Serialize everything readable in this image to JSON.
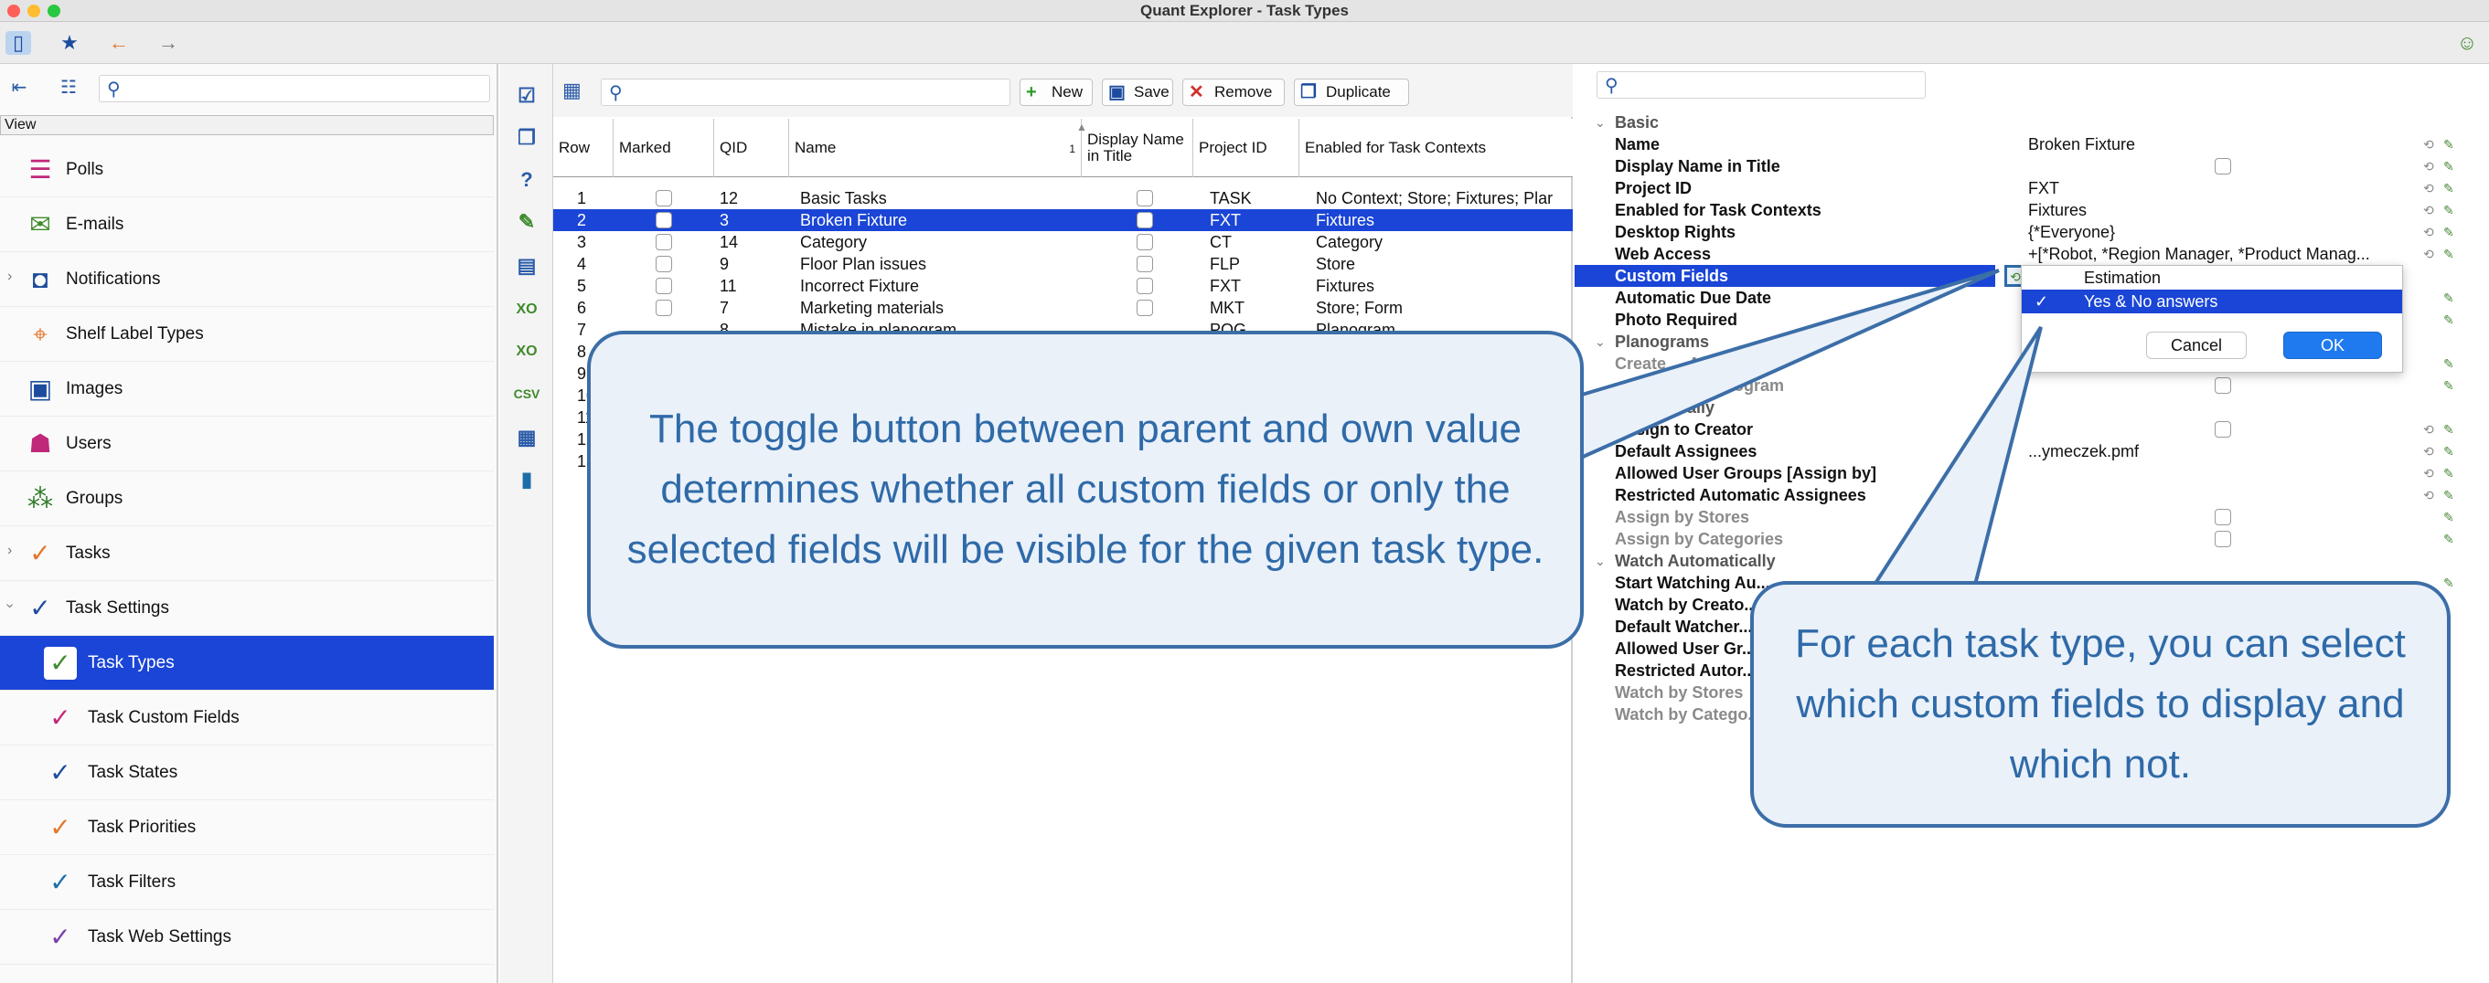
{
  "window": {
    "title": "Quant Explorer - Task Types"
  },
  "sidebar": {
    "view_label": "View",
    "items": [
      {
        "label": "Polls",
        "icon": "poll-icon",
        "color": "#c0287a"
      },
      {
        "label": "E-mails",
        "icon": "email-icon",
        "color": "#3f8a2c"
      },
      {
        "label": "Notifications",
        "icon": "bell-icon",
        "color": "#1d4c9e"
      },
      {
        "label": "Shelf Label Types",
        "icon": "shelf-label-icon",
        "color": "#e4762a"
      },
      {
        "label": "Images",
        "icon": "image-icon",
        "color": "#1d4c9e"
      },
      {
        "label": "Users",
        "icon": "user-icon",
        "color": "#c0287a"
      },
      {
        "label": "Groups",
        "icon": "groups-icon",
        "color": "#2f7a2a"
      },
      {
        "label": "Tasks",
        "icon": "tasks-icon",
        "color": "#e4762a"
      },
      {
        "label": "Task Settings",
        "icon": "task-settings-icon",
        "color": "#1d4c9e"
      },
      {
        "label": "Task Types",
        "icon": "task-types-icon",
        "color": "#3f8a2c"
      },
      {
        "label": "Task Custom Fields",
        "icon": "task-custom-fields-icon",
        "color": "#c0287a"
      },
      {
        "label": "Task States",
        "icon": "task-states-icon",
        "color": "#1d4c9e"
      },
      {
        "label": "Task Priorities",
        "icon": "task-priorities-icon",
        "color": "#e4762a"
      },
      {
        "label": "Task Filters",
        "icon": "task-filters-icon",
        "color": "#1d6ea8"
      },
      {
        "label": "Task Web Settings",
        "icon": "task-web-settings-icon",
        "color": "#7a3fa8"
      }
    ]
  },
  "table_toolbar": {
    "new_label": "New",
    "save_label": "Save",
    "remove_label": "Remove",
    "duplicate_label": "Duplicate"
  },
  "table": {
    "columns": [
      "Row",
      "Marked",
      "QID",
      "Name",
      "Display Name in Title",
      "Project ID",
      "Enabled for Task Contexts"
    ],
    "sort_indicator": "1",
    "rows": [
      {
        "row": "1",
        "qid": "12",
        "name": "Basic Tasks",
        "project": "TASK",
        "contexts": "No Context; Store; Fixtures; Plar"
      },
      {
        "row": "2",
        "qid": "3",
        "name": "Broken Fixture",
        "project": "FXT",
        "contexts": "Fixtures"
      },
      {
        "row": "3",
        "qid": "14",
        "name": "Category",
        "project": "CT",
        "contexts": "Category"
      },
      {
        "row": "4",
        "qid": "9",
        "name": "Floor Plan issues",
        "project": "FLP",
        "contexts": "Store"
      },
      {
        "row": "5",
        "qid": "11",
        "name": "Incorrect Fixture",
        "project": "FXT",
        "contexts": "Fixtures"
      },
      {
        "row": "6",
        "qid": "7",
        "name": "Marketing materials",
        "project": "MKT",
        "contexts": "Store; Form"
      },
      {
        "row": "7",
        "qid": "8",
        "name": "Mistake in planogram",
        "project": "POG",
        "contexts": "Planogram"
      },
      {
        "row": "8",
        "qid": "",
        "name": "",
        "project": "",
        "contexts": ""
      },
      {
        "row": "9",
        "qid": "",
        "name": "",
        "project": "",
        "contexts": ""
      },
      {
        "row": "10",
        "qid": "",
        "name": "",
        "project": "",
        "contexts": ""
      },
      {
        "row": "11",
        "qid": "",
        "name": "",
        "project": "",
        "contexts": ""
      },
      {
        "row": "12",
        "qid": "",
        "name": "",
        "project": "",
        "contexts": ""
      },
      {
        "row": "13",
        "qid": "",
        "name": "",
        "project": "",
        "contexts": ""
      }
    ]
  },
  "properties": {
    "basic_section": "Basic",
    "basic": [
      {
        "key": "Name",
        "value": "Broken Fixture"
      },
      {
        "key": "Display Name in Title",
        "value": ""
      },
      {
        "key": "Project ID",
        "value": "FXT"
      },
      {
        "key": "Enabled for Task Contexts",
        "value": "Fixtures"
      },
      {
        "key": "Desktop Rights",
        "value": "{*Everyone}"
      },
      {
        "key": "Web Access",
        "value": "+[*Robot, *Region Manager, *Product Manag..."
      },
      {
        "key": "Custom Fields",
        "value": ""
      },
      {
        "key": "Automatic Due Date",
        "value": ""
      },
      {
        "key": "Photo Required",
        "value": ""
      }
    ],
    "planograms_section": "Planograms",
    "planograms": [
      {
        "key": "Create ... Approve",
        "value": ""
      },
      {
        "key": "... Issue in Planogram",
        "value": ""
      }
    ],
    "assign_section": "...tomatically",
    "assign": [
      {
        "key": "Assign to Creator",
        "value": ""
      },
      {
        "key": "Default Assignees",
        "value": "...ymeczek.pmf"
      },
      {
        "key": "Allowed User Groups [Assign by]",
        "value": ""
      },
      {
        "key": "Restricted Automatic Assignees",
        "value": ""
      },
      {
        "key": "Assign by Stores",
        "value": ""
      },
      {
        "key": "Assign by Categories",
        "value": ""
      }
    ],
    "watch_section": "Watch Automatically",
    "watch": [
      {
        "key": "Start Watching Au...",
        "value": ""
      },
      {
        "key": "Watch by Creato...",
        "value": ""
      },
      {
        "key": "Default Watcher...",
        "value": ""
      },
      {
        "key": "Allowed User Gr...",
        "value": ""
      },
      {
        "key": "Restricted Autor...",
        "value": ""
      },
      {
        "key": "Watch by Stores",
        "value": ""
      },
      {
        "key": "Watch by Catego...",
        "value": ""
      }
    ]
  },
  "popup": {
    "options": [
      {
        "label": "Estimation",
        "checked": false
      },
      {
        "label": "Yes & No answers",
        "checked": true
      }
    ],
    "cancel_label": "Cancel",
    "ok_label": "OK"
  },
  "callouts": {
    "left": "The toggle button between parent and own value determines whether all custom fields or only the selected fields will be visible for the given task type.",
    "right": "For each task type, you can select which custom fields to display and which not."
  },
  "colors": {
    "selection": "#1a45d6",
    "callout_text": "#2f6aa8",
    "callout_border": "#3c6ea8",
    "callout_fill": "#eaf1f9"
  }
}
